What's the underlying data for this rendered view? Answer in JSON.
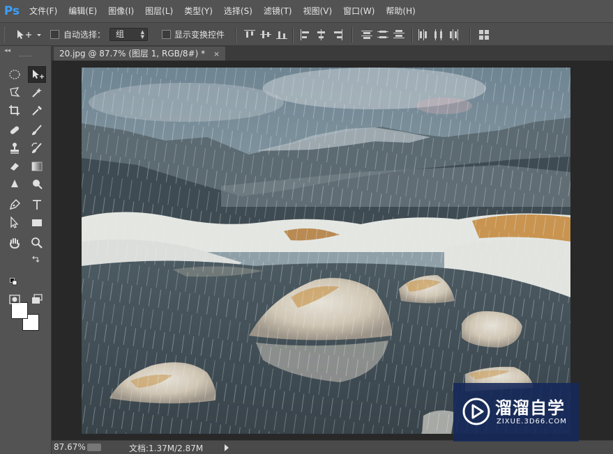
{
  "app": {
    "logo": "Ps"
  },
  "menubar": {
    "items": [
      "文件(F)",
      "编辑(E)",
      "图像(I)",
      "图层(L)",
      "类型(Y)",
      "选择(S)",
      "滤镜(T)",
      "视图(V)",
      "窗口(W)",
      "帮助(H)"
    ]
  },
  "options": {
    "auto_select_label": "自动选择：",
    "auto_select_value": "组",
    "show_transform_label": "显示变换控件"
  },
  "document": {
    "tab_title": "20.jpg @ 87.7% (图层 1, RGB/8#) *",
    "close_glyph": "×"
  },
  "status": {
    "zoom": "87.67%",
    "doc_size": "文档:1.37M/2.87M"
  },
  "watermark": {
    "title": "溜溜自学",
    "subtitle": "ZIXUE.3D66.COM"
  },
  "colors": {
    "foreground": "#ffffff",
    "background": "#ffffff",
    "logo_blue": "#3aa0ff"
  },
  "tools": [
    "marquee-icon",
    "move-icon",
    "lasso-icon",
    "magic-wand-icon",
    "crop-icon",
    "eyedropper-icon",
    "healing-brush-icon",
    "brush-icon",
    "clone-stamp-icon",
    "history-brush-icon",
    "eraser-icon",
    "gradient-icon",
    "blur-icon",
    "dodge-icon",
    "pen-icon",
    "type-icon",
    "path-select-icon",
    "rectangle-icon",
    "hand-icon",
    "zoom-icon"
  ]
}
